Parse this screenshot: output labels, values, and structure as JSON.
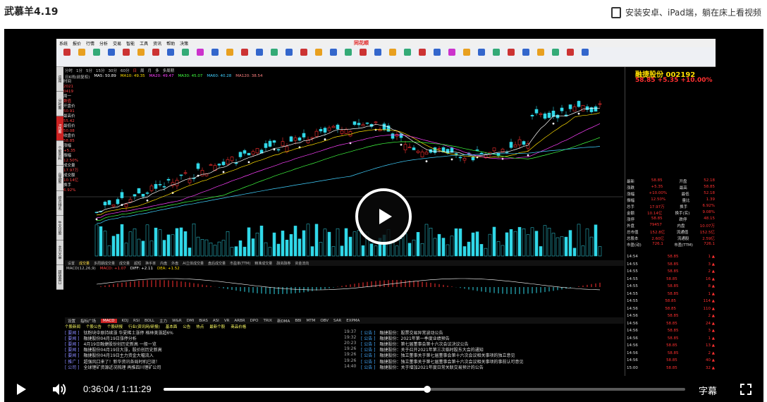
{
  "page": {
    "title": "武慕羊4.19",
    "promo_text": "安装安卓、iPad端，躺在床上看视频"
  },
  "screen": {
    "menu_items": [
      "系统",
      "报价",
      "行情",
      "分析",
      "交易",
      "智能",
      "工具",
      "资讯",
      "帮助",
      "决策"
    ],
    "brand": "同花顺",
    "toolbar_items": [
      "",
      "",
      "",
      "",
      "",
      "",
      "",
      "",
      "",
      "",
      "",
      "",
      "",
      "",
      "",
      "",
      "",
      "",
      "",
      "",
      "",
      "",
      "",
      "",
      "",
      "",
      "",
      "",
      "",
      "",
      "",
      "",
      "",
      "",
      "",
      ""
    ],
    "left_nav": [
      "应用",
      "分时图",
      "K线图",
      "个股资料",
      "自选股",
      "综合排名",
      "牛叉诊股",
      "主力大单",
      "超级盘口"
    ],
    "header_items": [
      "分时",
      "1分",
      "5分",
      "15分",
      "30分",
      "60分",
      "日",
      "周",
      "月",
      "多",
      "多周期"
    ],
    "ma_labels": [
      {
        "text": "日K线(前复权)",
        "color": "#cccccc"
      },
      {
        "text": "MA5: 50.89",
        "color": "#ffffff"
      },
      {
        "text": "MA10: 49.35",
        "color": "#ffde00"
      },
      {
        "text": "MA20: 49.47",
        "color": "#ff40ff"
      },
      {
        "text": "MA30: 45.07",
        "color": "#40ff40"
      },
      {
        "text": "MA60: 40.28",
        "color": "#40d0ff"
      },
      {
        "text": "MA120: 38.54",
        "color": "#ff8080"
      }
    ],
    "info_col": [
      {
        "label": "时间",
        "value": "2021"
      },
      {
        "label": "",
        "value": "0419"
      },
      {
        "label": "周一",
        "value": "数值"
      },
      {
        "label": "开盘价",
        "value": "50.91"
      },
      {
        "label": "最高价",
        "value": "55.42"
      },
      {
        "label": "最低价",
        "value": "50.08"
      },
      {
        "label": "收盘价",
        "value": "58.85"
      },
      {
        "label": "涨幅",
        "value": "+5.35"
      },
      {
        "label": "振幅",
        "value": "12.50%"
      },
      {
        "label": "成交量",
        "value": "17.97万"
      },
      {
        "label": "成交额",
        "value": "10.14亿"
      },
      {
        "label": "换手",
        "value": "6.92%"
      }
    ],
    "vol_label": "VOL: 14.24万  MAVOL10: 13.88万",
    "indicator_tabs": [
      "设置",
      "成交量",
      "多周期成交量",
      "成交量",
      "超短",
      "换手率",
      "内盘",
      "外盘",
      "AI立体成交量",
      "盘后成交量",
      "市盈率(TTM)",
      "精准成交量",
      "融资融券",
      "资金流向"
    ],
    "macd_labels": [
      {
        "text": "MACD(12,26,9)",
        "color": "#cccccc"
      },
      {
        "text": "MACD: +1.07",
        "color": "#ff4040"
      },
      {
        "text": "DIFF: +2.11",
        "color": "#ffffff"
      },
      {
        "text": "DEA: +1.52",
        "color": "#ffde00"
      }
    ],
    "bottom_tabs": [
      "设置",
      "指标广场",
      "MACD",
      "KDJ",
      "RSI",
      "BOLL",
      "主力",
      "W&R",
      "DMI",
      "BIAS",
      "ASI",
      "VR",
      "ARBR",
      "DPO",
      "TRIX",
      "新DMA",
      "BBI",
      "MTM",
      "OBV",
      "SAR",
      "EXPMA"
    ],
    "news_tabs": [
      "个股新闻",
      "个股公告",
      "个股研报",
      "行业(资讯网/研报)",
      "基本面",
      "公告",
      "热点",
      "最新个股",
      "商品价格"
    ],
    "news_left": [
      {
        "tag": "[ 要闻 ]",
        "text": "钛粉块中原持续涨 华夏稀土涨停 格林美涨超6%"
      },
      {
        "tag": "[ 要闻 ]",
        "text": "融捷股份04月19日涨停分析"
      },
      {
        "tag": "[ 要闻 ]",
        "text": "4月19日融捷股份创历史新高 一般一览"
      },
      {
        "tag": "[ 要闻 ]",
        "text": "融捷股份04月19日大涨，股价创历史新高"
      },
      {
        "tag": "[ 要闻 ]",
        "text": "融捷股份04月19日主力资金大幅流入"
      },
      {
        "tag": "[ 推广 ]",
        "text": "超强风口来了！新华资讯各局时机已现！"
      },
      {
        "tag": "[ 公司 ]",
        "text": "全球锂矿资源近况梳理 再推四川锂矿公司"
      }
    ],
    "news_right": [
      {
        "time": "19:37",
        "src": "[ 公告 ]",
        "text": "融捷股份：股票交易异常波动公告"
      },
      {
        "time": "19:32",
        "src": "[ 公告 ]",
        "text": "融捷股份：2021年第一季度业绩预告"
      },
      {
        "time": "20:23",
        "src": "[ 公告 ]",
        "text": "融捷股份：第七届董事会第十六次会议决议公告"
      },
      {
        "time": "19:26",
        "src": "[ 公告 ]",
        "text": "融捷股份：关于召开2021年第三次临时股东大会的通知"
      },
      {
        "time": "19:26",
        "src": "[ 公告 ]",
        "text": "融捷股份：独立董事关于第七届董事会第十六次会议相关事项的独立意见"
      },
      {
        "time": "19:26",
        "src": "[ 公告 ]",
        "text": "融捷股份：独立董事关于第七届董事会第十六次会议相关事项的事前认可意见"
      },
      {
        "time": "14:40",
        "src": "[ 公告 ]",
        "text": "融捷股份：关于增加2021年度日常关联交易预计的公告"
      }
    ],
    "right_panel": {
      "name": "融捷股份 002192",
      "price": "58.85  +5.35  +10.00%",
      "quote_rows": [
        {
          "l": "最新",
          "v": "58.85",
          "l2": "开盘",
          "v2": "52.18"
        },
        {
          "l": "涨跌",
          "v": "+5.35",
          "l2": "最高",
          "v2": "58.85"
        },
        {
          "l": "涨幅",
          "v": "+10.00%",
          "l2": "最低",
          "v2": "52.18"
        },
        {
          "l": "振幅",
          "v": "12.50%",
          "l2": "量比",
          "v2": "1.39"
        },
        {
          "l": "总手",
          "v": "17.97万",
          "l2": "换手",
          "v2": "6.92%"
        },
        {
          "l": "金额",
          "v": "10.14亿",
          "l2": "换手(实)",
          "v2": "9.08%"
        },
        {
          "l": "涨停",
          "v": "58.85",
          "l2": "跌停",
          "v2": "48.15"
        },
        {
          "l": "外盘",
          "v": "79457",
          "l2": "内盘",
          "v2": "10.07万"
        },
        {
          "l": "总市值",
          "v": "152.8亿",
          "l2": "流通值",
          "v2": "152.5亿"
        },
        {
          "l": "总股本",
          "v": "2.60亿",
          "l2": "流通股",
          "v2": "2.59亿"
        },
        {
          "l": "市盈(动)",
          "v": "726.1",
          "l2": "市盈(TTM)",
          "v2": "726.1"
        }
      ],
      "ticks": [
        {
          "t": "14:54",
          "p": "58.85",
          "v": "1"
        },
        {
          "t": "14:55",
          "p": "58.85",
          "v": "3"
        },
        {
          "t": "14:55",
          "p": "58.85",
          "v": "2"
        },
        {
          "t": "14:55",
          "p": "58.85",
          "v": "16"
        },
        {
          "t": "14:55",
          "p": "58.85",
          "v": "8"
        },
        {
          "t": "14:55",
          "p": "58.85",
          "v": "1"
        },
        {
          "t": "14:55",
          "p": "58.85",
          "v": "114"
        },
        {
          "t": "14:56",
          "p": "58.85",
          "v": "110"
        },
        {
          "t": "14:56",
          "p": "58.85",
          "v": "2"
        },
        {
          "t": "14:56",
          "p": "58.85",
          "v": "24"
        },
        {
          "t": "14:56",
          "p": "58.85",
          "v": "3"
        },
        {
          "t": "14:56",
          "p": "58.85",
          "v": "1"
        },
        {
          "t": "14:56",
          "p": "58.85",
          "v": "13"
        },
        {
          "t": "14:56",
          "p": "58.85",
          "v": "2"
        },
        {
          "t": "14:56",
          "p": "58.85",
          "v": "40"
        },
        {
          "t": "15:00",
          "p": "58.85",
          "v": "32"
        }
      ]
    }
  },
  "controls": {
    "time": "0:36:04  /  1:11:29",
    "progress": 0.505,
    "caption": "字幕"
  },
  "colors": {
    "rise": "#ff3030",
    "fall": "#30d8e8",
    "title": "#ffde00"
  }
}
